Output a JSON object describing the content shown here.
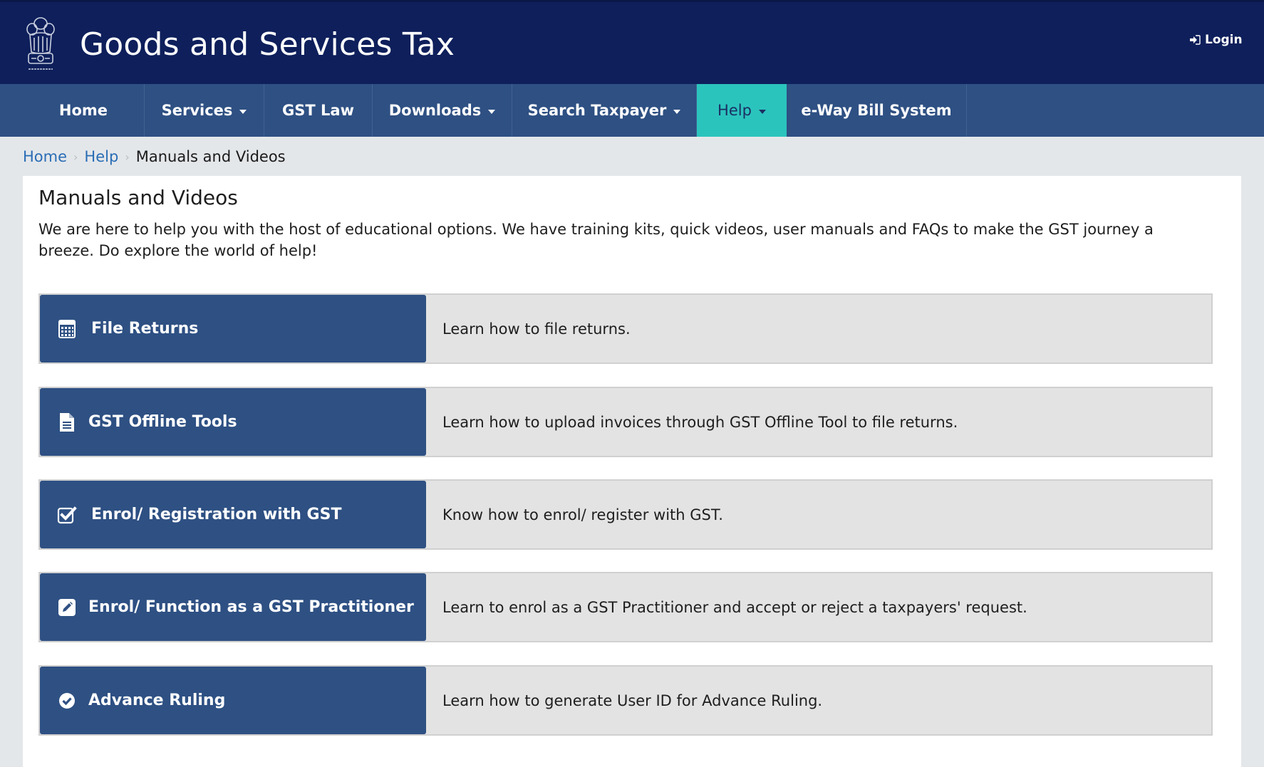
{
  "header": {
    "title": "Goods and Services Tax",
    "logo": "emblem-of-india-logo",
    "login_label": "Login",
    "login_icon": "sign-in-icon"
  },
  "nav": {
    "items": [
      {
        "label": "Home",
        "has_caret": false,
        "active": false
      },
      {
        "label": "Services",
        "has_caret": true,
        "active": false
      },
      {
        "label": "GST Law",
        "has_caret": false,
        "active": false
      },
      {
        "label": "Downloads",
        "has_caret": true,
        "active": false
      },
      {
        "label": "Search Taxpayer",
        "has_caret": true,
        "active": false
      },
      {
        "label": "Help",
        "has_caret": true,
        "active": true
      },
      {
        "label": "e-Way Bill System",
        "has_caret": false,
        "active": false
      }
    ]
  },
  "breadcrumb": {
    "items": [
      "Home",
      "Help"
    ],
    "current": "Manuals and Videos",
    "separator": "›"
  },
  "main": {
    "title": "Manuals and Videos",
    "description": "We are here to help you with the host of educational options. We have training kits, quick videos, user manuals and FAQs to make the GST journey a breeze. Do explore the world of help!",
    "cards": [
      {
        "title": "File Returns",
        "icon": "calculator-icon",
        "description": "Learn how to file returns."
      },
      {
        "title": "GST Offline Tools",
        "icon": "file-text-icon",
        "description": "Learn how to upload invoices through GST Offline Tool to file returns."
      },
      {
        "title": "Enrol/ Registration with GST",
        "icon": "check-square-icon",
        "description": "Know how to enrol/ register with GST."
      },
      {
        "title": "Enrol/ Function as a GST Practitioner",
        "icon": "pencil-square-icon",
        "description": "Learn to enrol as a GST Practitioner and accept or reject a taxpayers' request."
      },
      {
        "title": "Advance Ruling",
        "icon": "check-circle-icon",
        "description": "Learn how to generate User ID for Advance Ruling."
      }
    ]
  },
  "colors": {
    "header_bg": "#0e1f5b",
    "nav_bg": "#2e5083",
    "nav_active": "#2bc4bd",
    "card_head_bg": "#2e5083",
    "card_body_bg": "#e3e3e3",
    "link": "#2a6db5",
    "page_bg": "#e4e7ea"
  }
}
